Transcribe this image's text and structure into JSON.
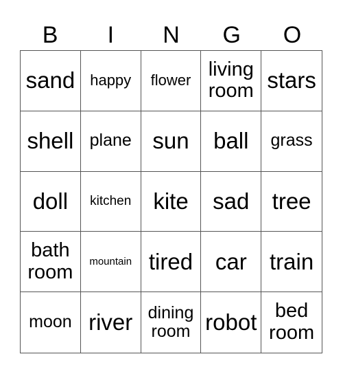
{
  "header": [
    "B",
    "I",
    "N",
    "G",
    "O"
  ],
  "cells": [
    "sand",
    "happy",
    "flower",
    "living\nroom",
    "stars",
    "shell",
    "plane",
    "sun",
    "ball",
    "grass",
    "doll",
    "kitchen",
    "kite",
    "sad",
    "tree",
    "bath\nroom",
    "mountain",
    "tired",
    "car",
    "train",
    "moon",
    "river",
    "dining\nroom",
    "robot",
    "bed\nroom"
  ]
}
